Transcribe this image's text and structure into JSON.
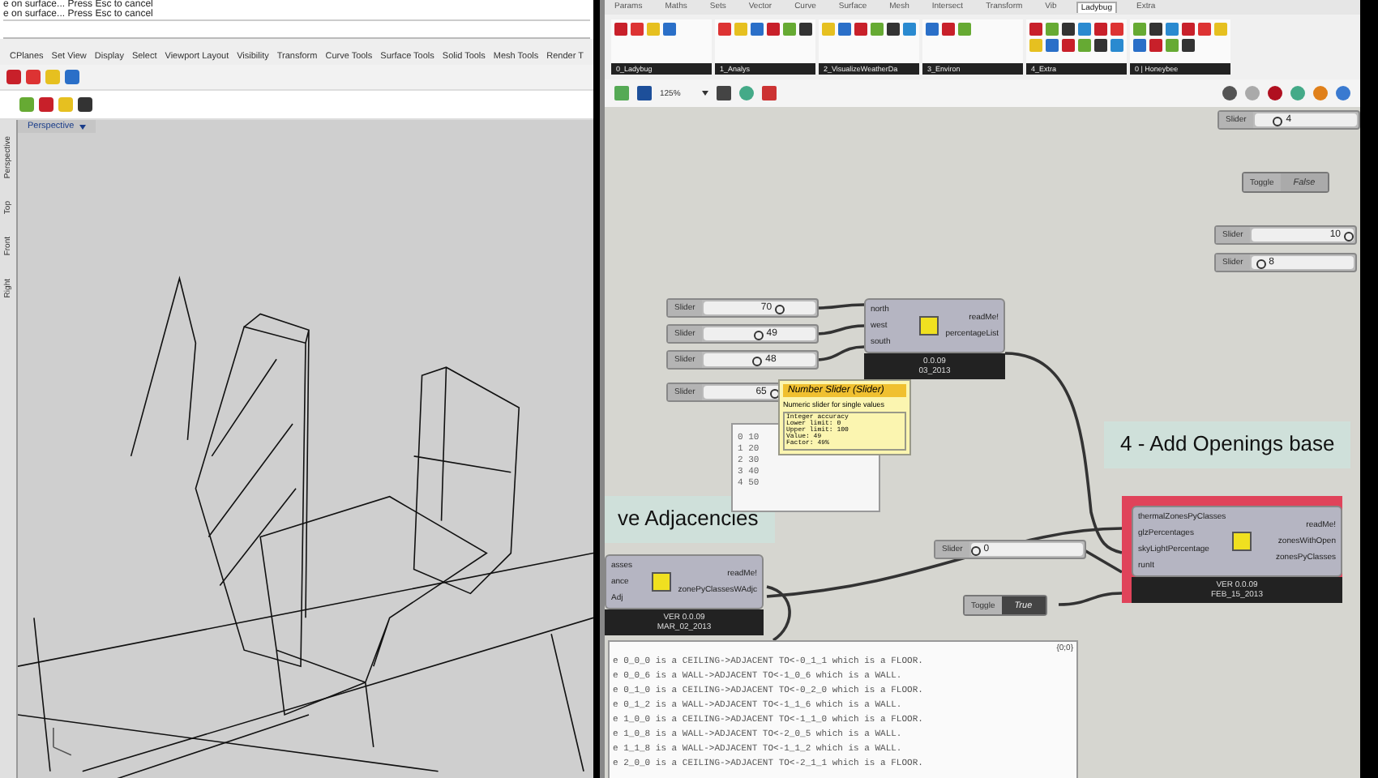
{
  "rhino": {
    "command_history": [
      "e on surface... Press Esc to cancel",
      "e on surface... Press Esc to cancel"
    ],
    "tabs": [
      "CPlanes",
      "Set View",
      "Display",
      "Select",
      "Viewport Layout",
      "Visibility",
      "Transform",
      "Curve Tools",
      "Surface Tools",
      "Solid Tools",
      "Mesh Tools",
      "Render T"
    ],
    "side_tabs": [
      "Perspective",
      "Top",
      "Front",
      "Right"
    ],
    "viewport": {
      "title": "Perspective"
    }
  },
  "grasshopper": {
    "tabs": [
      {
        "label": "Params",
        "selected": false
      },
      {
        "label": "Maths",
        "selected": false
      },
      {
        "label": "Sets",
        "selected": false
      },
      {
        "label": "Vector",
        "selected": false
      },
      {
        "label": "Curve",
        "selected": false
      },
      {
        "label": "Surface",
        "selected": false
      },
      {
        "label": "Mesh",
        "selected": false
      },
      {
        "label": "Intersect",
        "selected": false
      },
      {
        "label": "Transform",
        "selected": false
      },
      {
        "label": "Vib",
        "selected": false
      },
      {
        "label": "Ladybug",
        "selected": true
      },
      {
        "label": "Extra",
        "selected": false
      }
    ],
    "tool_groups": [
      "0_Ladybug",
      "1_Analys",
      "2_VisualizeWeatherDa",
      "3_Environ",
      "4_Extra",
      "0 | Honeybee"
    ],
    "zoom": "125%",
    "sliders": [
      {
        "label": "Slider",
        "value": "4",
        "level": 0.2
      },
      {
        "label": "Slider",
        "value": "10",
        "level": 1
      },
      {
        "label": "Slider",
        "value": "8",
        "level": 0.05
      },
      {
        "label": "Slider",
        "value": "70",
        "level": 0.7
      },
      {
        "label": "Slider",
        "value": "49",
        "level": 0.49
      },
      {
        "label": "Slider",
        "value": "48",
        "level": 0.48
      },
      {
        "label": "Slider",
        "value": "65",
        "level": 0.65
      },
      {
        "label": "Slider",
        "value": "0",
        "level": 0
      }
    ],
    "toggles": [
      {
        "label": "Toggle",
        "value": "False",
        "on": false
      },
      {
        "label": "Toggle",
        "value": "True",
        "on": true
      }
    ],
    "components": [
      {
        "inputs": [
          "north",
          "west",
          "south"
        ],
        "outputs": [
          "readMe!",
          "percentageList"
        ],
        "footer": [
          "0.0.09",
          "03_2013"
        ],
        "selected": false
      },
      {
        "inputs": [
          "thermalZonesPyClasses",
          "glzPercentages",
          "skyLightPercentage",
          "runIt"
        ],
        "outputs": [
          "readMe!",
          "zonesWithOpen",
          "zonesPyClasses"
        ],
        "footer": [
          "VER 0.0.09",
          "FEB_15_2013"
        ],
        "selected": true
      },
      {
        "inputs": [
          "asses",
          "ance",
          "Adj"
        ],
        "outputs": [
          "readMe!",
          "zonePyClassesWAdjc"
        ],
        "footer": [
          "VER 0.0.09",
          "MAR_02_2013"
        ],
        "selected": false
      }
    ],
    "groups": [
      "4 - Add Openings base",
      "ve Adjacencies"
    ],
    "tooltip": {
      "title": "Number Slider (Slider)",
      "description": "Numeric slider for single values",
      "details": [
        "Integer accuracy",
        "Lower limit: 0",
        "Upper limit: 100",
        "Value: 49",
        "Factor: 49%"
      ]
    },
    "list_panel": [
      "0 10",
      "1 20",
      "2 30",
      "3 40",
      "4 50"
    ],
    "output_panel": {
      "path": "{0;0}",
      "lines": [
        "e 0_0_0 is a CEILING->ADJACENT TO<-0_1_1 which is a FLOOR.",
        "e 0_0_6 is a WALL->ADJACENT TO<-1_0_6 which is a WALL.",
        "e 0_1_0 is a CEILING->ADJACENT TO<-0_2_0 which is a FLOOR.",
        "e 0_1_2 is a WALL->ADJACENT TO<-1_1_6 which is a WALL.",
        "e 1_0_0 is a CEILING->ADJACENT TO<-1_1_0 which is a FLOOR.",
        "e 1_0_8 is a WALL->ADJACENT TO<-2_0_5 which is a WALL.",
        "e 1_1_8 is a WALL->ADJACENT TO<-1_1_2 which is a WALL.",
        "e 2_0_0 is a CEILING->ADJACENT TO<-2_1_1 which is a FLOOR."
      ]
    }
  }
}
